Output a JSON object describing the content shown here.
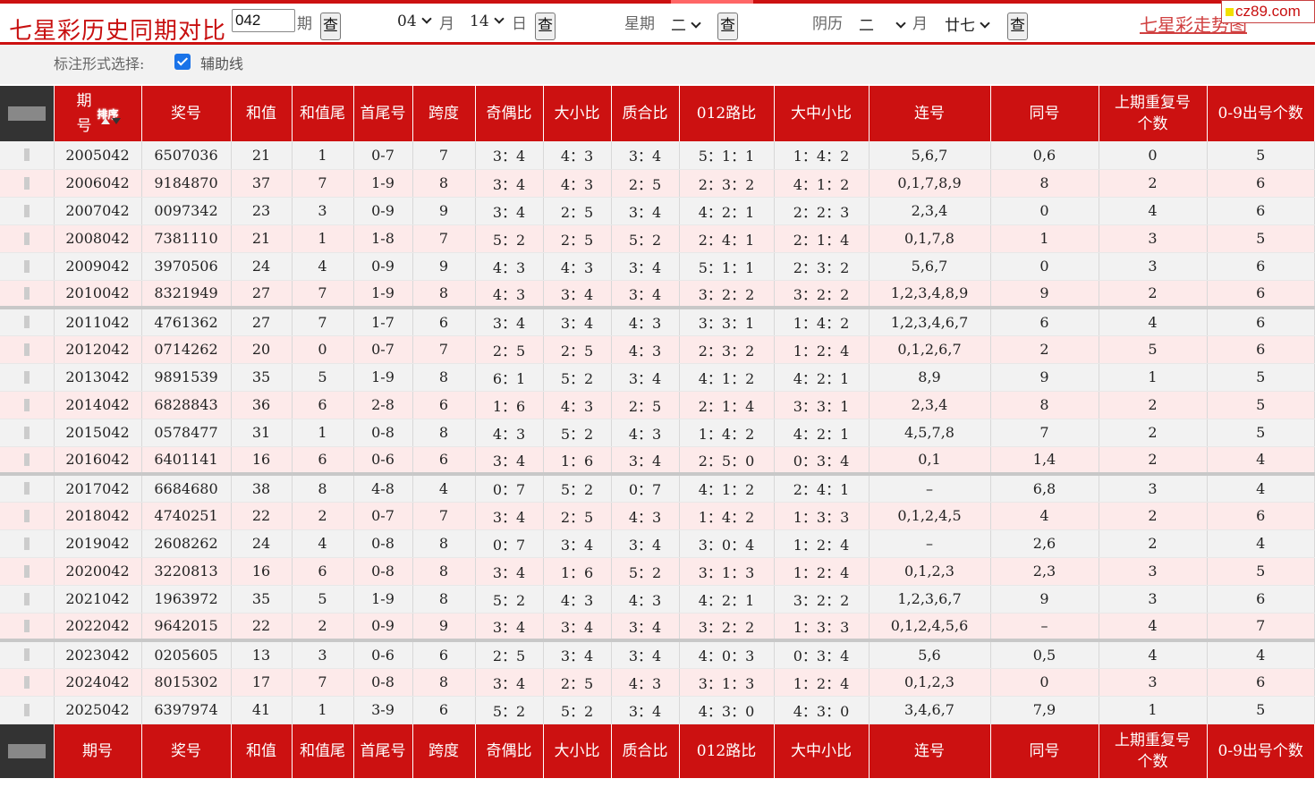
{
  "header": {
    "title": "七星彩历史同期对比",
    "period_input": "042",
    "period_label": "期",
    "query_label": "查",
    "month_value": "04",
    "month_label": "月",
    "day_value": "14",
    "day_label": "日",
    "weekday_label": "星期",
    "weekday_value": "二",
    "lunar_label": "阴历",
    "lunar_month_value": "二",
    "lunar_month_label": "月",
    "lunar_day_value": "廿七",
    "trend_link": "七星彩走势图",
    "watermark": "cz89.com"
  },
  "options": {
    "label": "标注形式选择:",
    "aux_line": "辅助线",
    "aux_checked": true
  },
  "table": {
    "sort_label": "排序",
    "head": [
      "期号",
      "奖号",
      "和值",
      "和值尾",
      "首尾号",
      "跨度",
      "奇偶比",
      "大小比",
      "质合比",
      "012路比",
      "大中小比",
      "连号",
      "同号",
      "上期重复号个数",
      "0-9出号个数"
    ],
    "head_period_top": "期",
    "head_period_bottom": "号",
    "head_repeat_top": "上期重复号",
    "head_repeat_bottom": "个数",
    "rows": [
      [
        "2005042",
        "6507036",
        "21",
        "1",
        "0-7",
        "7",
        "3：4",
        "4：3",
        "3：4",
        "5：1：1",
        "1：4：2",
        "5,6,7",
        "0,6",
        "0",
        "5"
      ],
      [
        "2006042",
        "9184870",
        "37",
        "7",
        "1-9",
        "8",
        "3：4",
        "4：3",
        "2：5",
        "2：3：2",
        "4：1：2",
        "0,1,7,8,9",
        "8",
        "2",
        "6"
      ],
      [
        "2007042",
        "0097342",
        "23",
        "3",
        "0-9",
        "9",
        "3：4",
        "2：5",
        "3：4",
        "4：2：1",
        "2：2：3",
        "2,3,4",
        "0",
        "4",
        "6"
      ],
      [
        "2008042",
        "7381110",
        "21",
        "1",
        "1-8",
        "7",
        "5：2",
        "2：5",
        "5：2",
        "2：4：1",
        "2：1：4",
        "0,1,7,8",
        "1",
        "3",
        "5"
      ],
      [
        "2009042",
        "3970506",
        "24",
        "4",
        "0-9",
        "9",
        "4：3",
        "4：3",
        "3：4",
        "5：1：1",
        "2：3：2",
        "5,6,7",
        "0",
        "3",
        "6"
      ],
      [
        "2010042",
        "8321949",
        "27",
        "7",
        "1-9",
        "8",
        "4：3",
        "3：4",
        "3：4",
        "3：2：2",
        "3：2：2",
        "1,2,3,4,8,9",
        "9",
        "2",
        "6"
      ],
      [
        "2011042",
        "4761362",
        "27",
        "7",
        "1-7",
        "6",
        "3：4",
        "3：4",
        "4：3",
        "3：3：1",
        "1：4：2",
        "1,2,3,4,6,7",
        "6",
        "4",
        "6"
      ],
      [
        "2012042",
        "0714262",
        "20",
        "0",
        "0-7",
        "7",
        "2：5",
        "2：5",
        "4：3",
        "2：3：2",
        "1：2：4",
        "0,1,2,6,7",
        "2",
        "5",
        "6"
      ],
      [
        "2013042",
        "9891539",
        "35",
        "5",
        "1-9",
        "8",
        "6：1",
        "5：2",
        "3：4",
        "4：1：2",
        "4：2：1",
        "8,9",
        "9",
        "1",
        "5"
      ],
      [
        "2014042",
        "6828843",
        "36",
        "6",
        "2-8",
        "6",
        "1：6",
        "4：3",
        "2：5",
        "2：1：4",
        "3：3：1",
        "2,3,4",
        "8",
        "2",
        "5"
      ],
      [
        "2015042",
        "0578477",
        "31",
        "1",
        "0-8",
        "8",
        "4：3",
        "5：2",
        "4：3",
        "1：4：2",
        "4：2：1",
        "4,5,7,8",
        "7",
        "2",
        "5"
      ],
      [
        "2016042",
        "6401141",
        "16",
        "6",
        "0-6",
        "6",
        "3：4",
        "1：6",
        "3：4",
        "2：5：0",
        "0：3：4",
        "0,1",
        "1,4",
        "2",
        "4"
      ],
      [
        "2017042",
        "6684680",
        "38",
        "8",
        "4-8",
        "4",
        "0：7",
        "5：2",
        "0：7",
        "4：1：2",
        "2：4：1",
        "–",
        "6,8",
        "3",
        "4"
      ],
      [
        "2018042",
        "4740251",
        "22",
        "2",
        "0-7",
        "7",
        "3：4",
        "2：5",
        "4：3",
        "1：4：2",
        "1：3：3",
        "0,1,2,4,5",
        "4",
        "2",
        "6"
      ],
      [
        "2019042",
        "2608262",
        "24",
        "4",
        "0-8",
        "8",
        "0：7",
        "3：4",
        "3：4",
        "3：0：4",
        "1：2：4",
        "–",
        "2,6",
        "2",
        "4"
      ],
      [
        "2020042",
        "3220813",
        "16",
        "6",
        "0-8",
        "8",
        "3：4",
        "1：6",
        "5：2",
        "3：1：3",
        "1：2：4",
        "0,1,2,3",
        "2,3",
        "3",
        "5"
      ],
      [
        "2021042",
        "1963972",
        "35",
        "5",
        "1-9",
        "8",
        "5：2",
        "4：3",
        "4：3",
        "4：2：1",
        "3：2：2",
        "1,2,3,6,7",
        "9",
        "3",
        "6"
      ],
      [
        "2022042",
        "9642015",
        "22",
        "2",
        "0-9",
        "9",
        "3：4",
        "3：4",
        "3：4",
        "3：2：2",
        "1：3：3",
        "0,1,2,4,5,6",
        "–",
        "4",
        "7"
      ],
      [
        "2023042",
        "0205605",
        "13",
        "3",
        "0-6",
        "6",
        "2：5",
        "3：4",
        "3：4",
        "4：0：3",
        "0：3：4",
        "5,6",
        "0,5",
        "4",
        "4"
      ],
      [
        "2024042",
        "8015302",
        "17",
        "7",
        "0-8",
        "8",
        "3：4",
        "2：5",
        "4：3",
        "3：1：3",
        "1：2：4",
        "0,1,2,3",
        "0",
        "3",
        "6"
      ],
      [
        "2025042",
        "6397974",
        "41",
        "1",
        "3-9",
        "6",
        "5：2",
        "5：2",
        "3：4",
        "4：3：0",
        "4：3：0",
        "3,4,6,7",
        "7,9",
        "1",
        "5"
      ]
    ]
  }
}
